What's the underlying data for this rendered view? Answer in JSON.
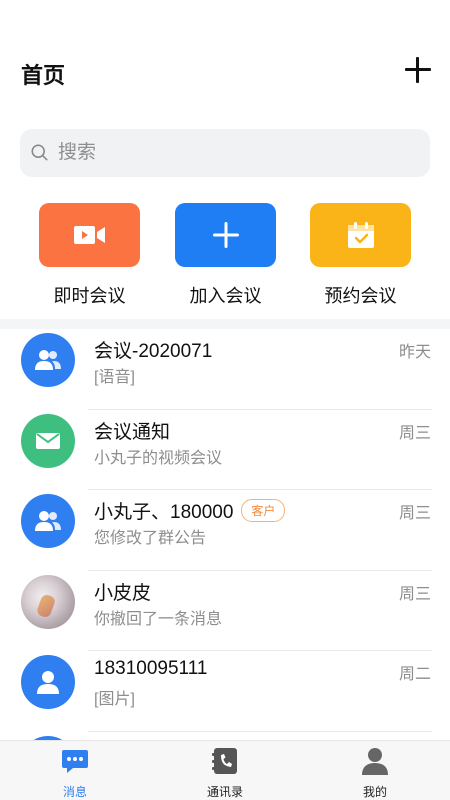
{
  "header": {
    "title": "首页"
  },
  "search": {
    "placeholder": "搜索"
  },
  "actions": [
    {
      "label": "即时会议",
      "color": "#fb7340",
      "icon": "video-camera-icon"
    },
    {
      "label": "加入会议",
      "color": "#1f7ef4",
      "icon": "plus-icon"
    },
    {
      "label": "预约会议",
      "color": "#fbb418",
      "icon": "calendar-check-icon"
    }
  ],
  "conversations": [
    {
      "name": "会议-2020071",
      "preview": "[语音]",
      "time": "昨天",
      "avatar": "group-icon",
      "avatar_color": "#2f7ff1"
    },
    {
      "name": "会议通知",
      "preview": "小丸子的视频会议",
      "time": "周三",
      "avatar": "mail-icon",
      "avatar_color": "#3fbf7f"
    },
    {
      "name": "小丸子、180000",
      "badge": "客户",
      "preview": "您修改了群公告",
      "time": "周三",
      "avatar": "group-icon",
      "avatar_color": "#2f7ff1"
    },
    {
      "name": "小皮皮",
      "preview": "你撤回了一条消息",
      "time": "周三",
      "avatar": "photo",
      "avatar_color": "#c7bdc2"
    },
    {
      "name": "18310095111",
      "preview": "[图片]",
      "time": "周二",
      "avatar": "person-icon",
      "avatar_color": "#2f7ff1"
    }
  ],
  "tabbar": [
    {
      "label": "消息",
      "icon": "chat-bubble-icon",
      "active": true
    },
    {
      "label": "通讯录",
      "icon": "phonebook-icon",
      "active": false
    },
    {
      "label": "我的",
      "icon": "profile-icon",
      "active": false
    }
  ],
  "colors": {
    "accent": "#2f7ff1",
    "divider": "#e8e8e8",
    "muted_text": "#8e8e8e"
  }
}
